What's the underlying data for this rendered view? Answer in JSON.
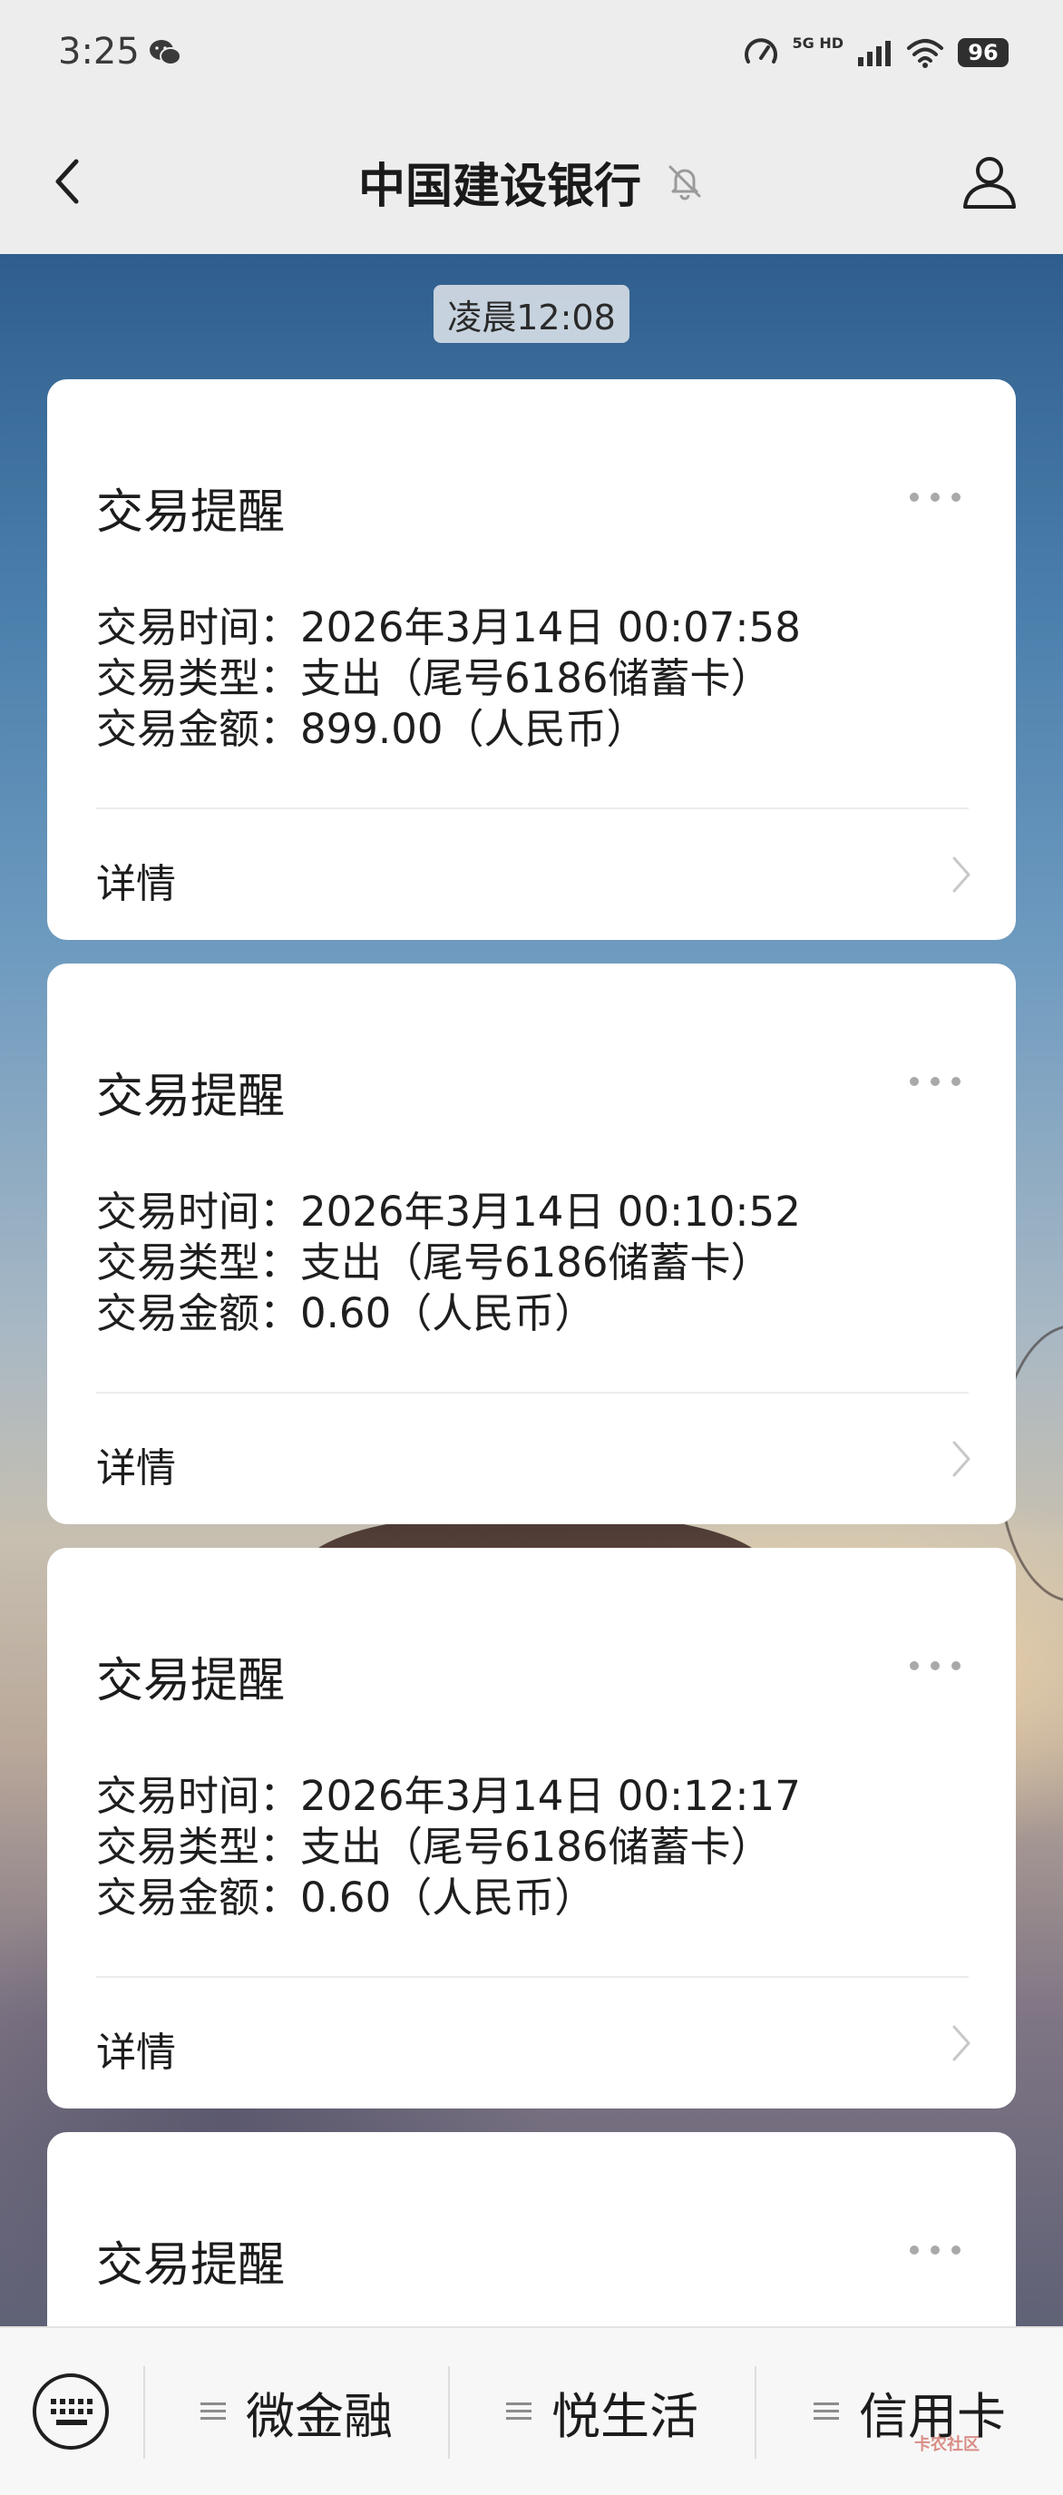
{
  "status_bar": {
    "time": "3:25",
    "network": "5G HD",
    "battery": "96",
    "icons": [
      "wechat-icon",
      "speed-gauge-icon",
      "signal-icon",
      "wifi-icon",
      "battery-icon"
    ]
  },
  "nav": {
    "title": "中国建设银行",
    "icons": [
      "back-chevron-icon",
      "mute-bell-icon",
      "profile-icon"
    ]
  },
  "chat": {
    "timestamp": "凌晨12:08",
    "cards": [
      {
        "title": "交易提醒",
        "lines": [
          "交易时间：2026年3月14日 00:07:58",
          "交易类型：支出（尾号6186储蓄卡）",
          "交易金额：899.00（人民币）"
        ],
        "details_label": "详情"
      },
      {
        "title": "交易提醒",
        "lines": [
          "交易时间：2026年3月14日 00:10:52",
          "交易类型：支出（尾号6186储蓄卡）",
          "交易金额：0.60（人民币）"
        ],
        "details_label": "详情"
      },
      {
        "title": "交易提醒",
        "lines": [
          "交易时间：2026年3月14日 00:12:17",
          "交易类型：支出（尾号6186储蓄卡）",
          "交易金额：0.60（人民币）"
        ],
        "details_label": "详情"
      },
      {
        "title": "交易提醒"
      }
    ]
  },
  "bottom_menu": {
    "items": [
      {
        "label": "微金融"
      },
      {
        "label": "悦生活"
      },
      {
        "label": "信用卡"
      }
    ],
    "keyboard_icon": "keyboard-icon",
    "watermark": "卡农社区"
  },
  "colors": {
    "bar_background": "#ededed",
    "card_background": "#ffffff",
    "text": "#1c1c1c"
  }
}
